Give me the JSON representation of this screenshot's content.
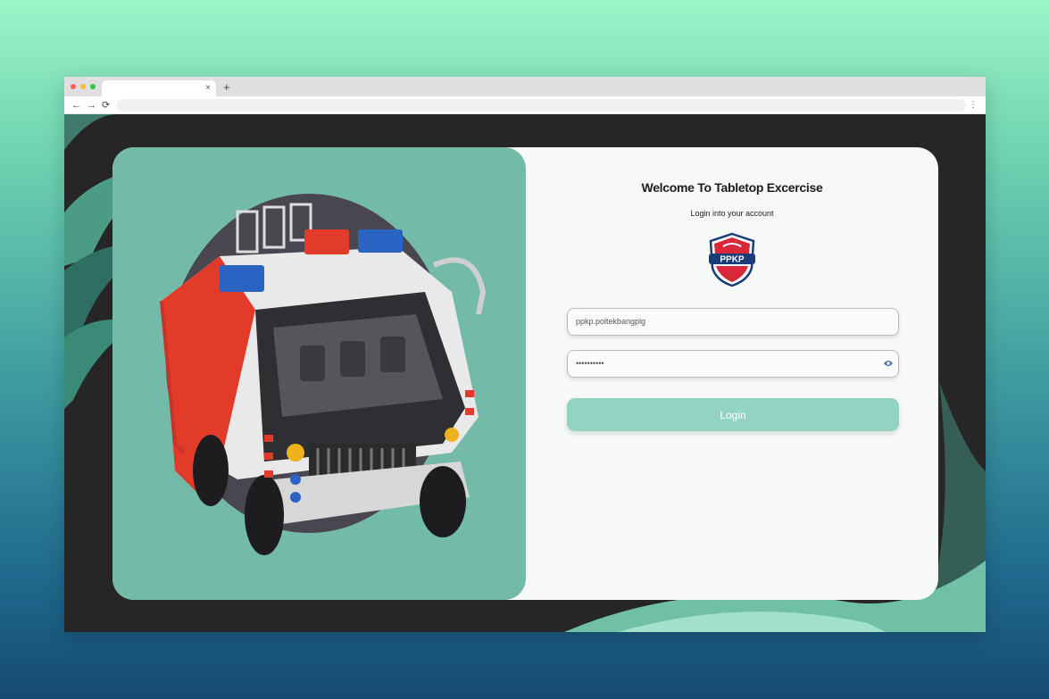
{
  "browser": {
    "tab_close": "×",
    "tab_new": "+",
    "nav_back": "←",
    "nav_forward": "→",
    "nav_reload": "⟳",
    "menu": "⋮",
    "window_dot_colors": [
      "#ff5f57",
      "#febc2e",
      "#28c840"
    ]
  },
  "login": {
    "title": "Welcome To Tabletop Excercise",
    "subtitle": "Login into your account",
    "logo_text": "PPKP",
    "username_value": "ppkp.poltekbangplg",
    "password_value": "••••••••••",
    "password_toggle_icon": "eye-icon",
    "login_label": "Login"
  },
  "colors": {
    "left_panel": "#74baa8",
    "login_button": "#92d3c3",
    "background_top": "#9cf4c8",
    "background_bottom": "#164a74"
  }
}
